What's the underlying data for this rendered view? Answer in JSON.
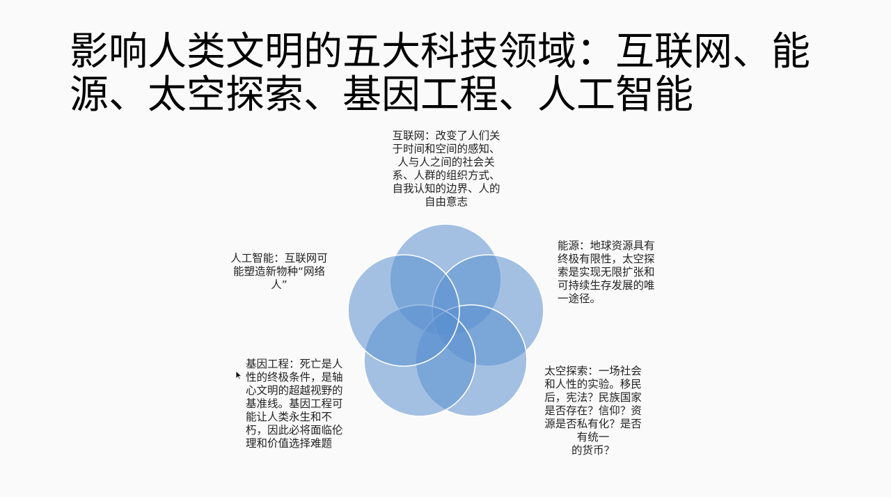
{
  "slide": {
    "title": "影响人类文明的五大科技领域：互联网、能源、太空探索、基因工程、人工智能"
  },
  "diagram": {
    "type": "venn",
    "circle_color": "#5b8fcf",
    "items": [
      {
        "name": "互联网",
        "text": "互联网：改变了人们关于时间和空间的感知、人与人之间的社会关系、人群的组织方式、自我认知的边界、人的自由意志"
      },
      {
        "name": "能源",
        "text": "能源：地球资源具有终极有限性，太空探索是实现无限扩张和可持续生存发展的唯一途径。"
      },
      {
        "name": "太空探索",
        "text": "太空探索：一场社会和人性的实验。移民后，宪法？民族国家是否存在？信仰？资源是否私有化？是否有统一",
        "text_last": "的货币？"
      },
      {
        "name": "基因工程",
        "text": "基因工程：死亡是人性的终极条件，是轴心文明的超越视野的基准线。基因工程可能让人类永生和不朽，因此必将面临伦理和价值选择难题"
      },
      {
        "name": "人工智能",
        "text": "人工智能：互联网可能塑造新物种“网络人”"
      }
    ]
  }
}
